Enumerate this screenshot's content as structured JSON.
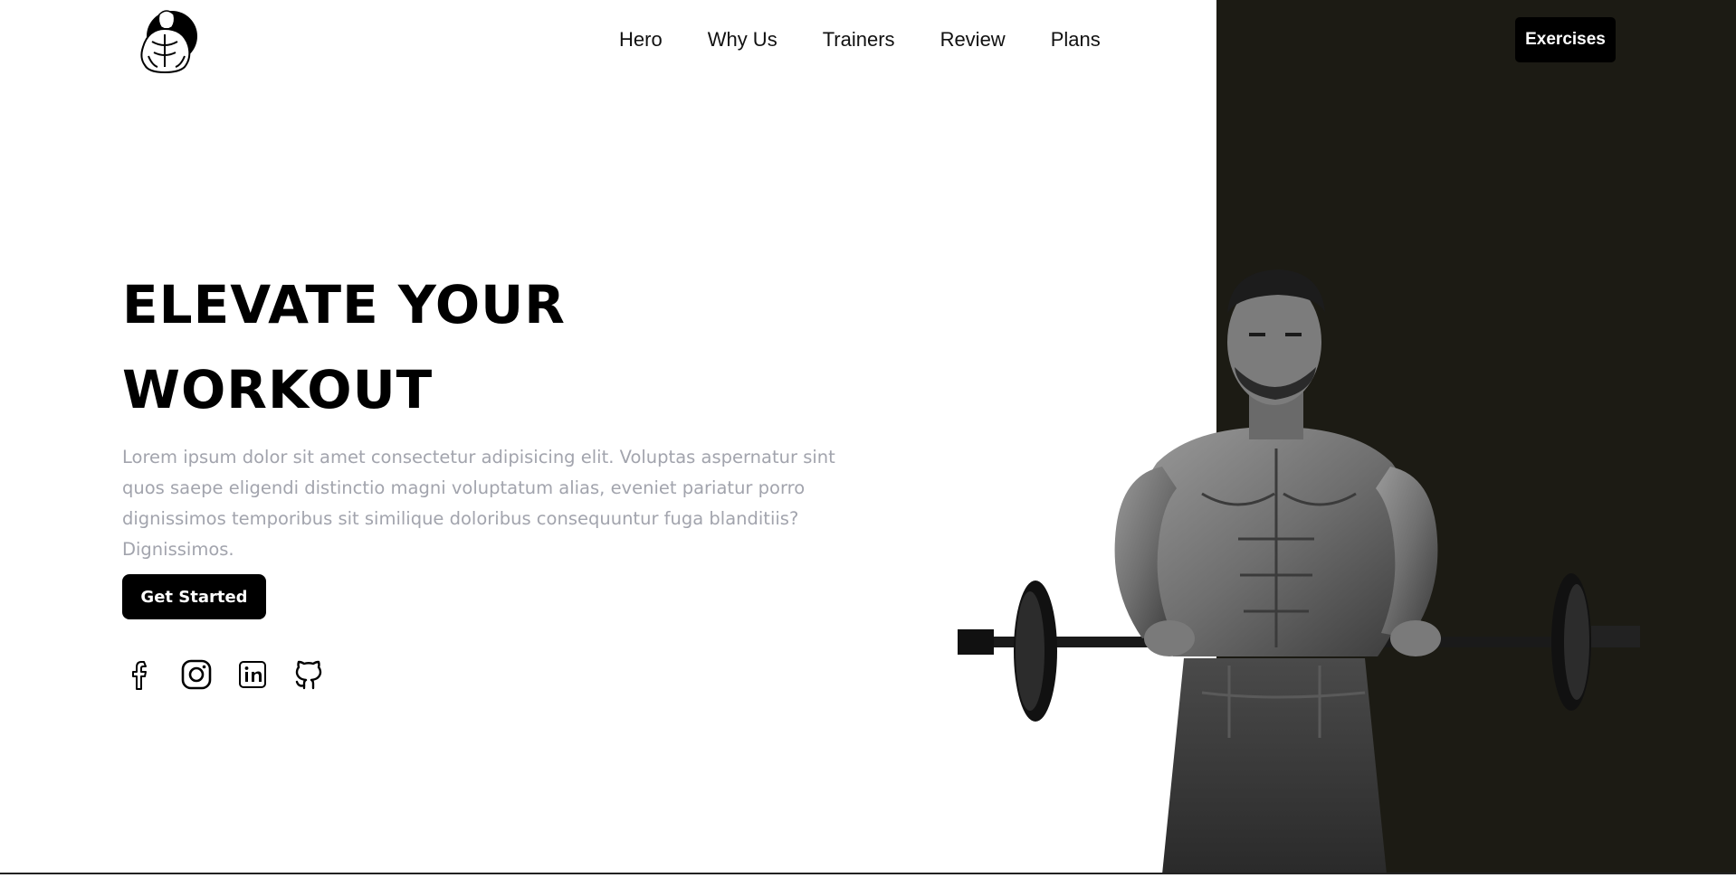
{
  "brand": {
    "logo_icon": "bodybuilder-logo-icon"
  },
  "nav": {
    "items": [
      {
        "label": "Hero"
      },
      {
        "label": "Why Us"
      },
      {
        "label": "Trainers"
      },
      {
        "label": "Review"
      },
      {
        "label": "Plans"
      }
    ],
    "cta_label": "Exercises"
  },
  "hero": {
    "title_line1": "ELEVATE YOUR",
    "title_line2": "WORKOUT",
    "description": "Lorem ipsum dolor sit amet consectetur adipisicing elit. Voluptas aspernatur sint quos saepe eligendi distinctio magni voluptatum alias, eveniet pariatur porro dignissimos temporibus sit similique doloribus consequuntur fuga blanditiis? Dignissimos.",
    "button_label": "Get Started",
    "image_icon": "athlete-barbell-image"
  },
  "socials": [
    "facebook-icon",
    "instagram-icon",
    "linkedin-icon",
    "github-icon"
  ],
  "colors": {
    "panel": "#1c1b14",
    "text": "#000000",
    "muted": "#a2a4ad",
    "button_bg": "#000000",
    "button_text": "#ffffff"
  }
}
